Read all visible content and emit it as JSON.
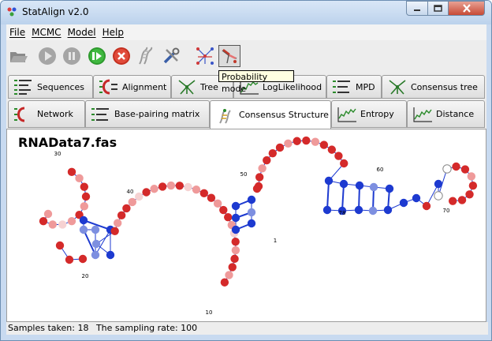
{
  "window": {
    "title": "StatAlign v2.0"
  },
  "menu": {
    "items": [
      "File",
      "MCMC",
      "Model",
      "Help"
    ]
  },
  "toolbar": {
    "buttons": [
      {
        "name": "open-folder-icon"
      },
      {
        "name": "play-icon"
      },
      {
        "name": "pause-icon"
      },
      {
        "name": "resume-icon"
      },
      {
        "name": "stop-icon"
      },
      {
        "name": "rna-mode-icon"
      },
      {
        "name": "settings-tools-icon"
      },
      {
        "name": "network-mode-icon"
      },
      {
        "name": "probability-mode-icon"
      }
    ],
    "tooltip": "Probability mode",
    "colors": {
      "play": "#9c9c9c",
      "resume": "#2e9a2e",
      "stop": "#d23a2a"
    }
  },
  "tabs": {
    "row1": [
      "Sequences",
      "Alignment",
      "Tree",
      "LogLikelihood",
      "MPD",
      "Consensus tree"
    ],
    "row2": [
      "Network",
      "Base-pairing matrix",
      "Consensus Structure",
      "Entropy",
      "Distance"
    ],
    "selected": "Consensus Structure"
  },
  "panel": {
    "filename": "RNAData7.fas"
  },
  "structure": {
    "position_labels": [
      "30",
      "40",
      "50",
      "60",
      "20",
      "10",
      "78",
      "70",
      "1"
    ],
    "color_scale": {
      "high": "#d42a2a",
      "mid": "#ef9a9a",
      "pale": "#f6d2d2",
      "blue": "#1d3ad0",
      "lightblue": "#7d8fe0"
    }
  },
  "status": {
    "samples_label": "Samples taken: 18",
    "rate_label": "The sampling rate: 100"
  }
}
